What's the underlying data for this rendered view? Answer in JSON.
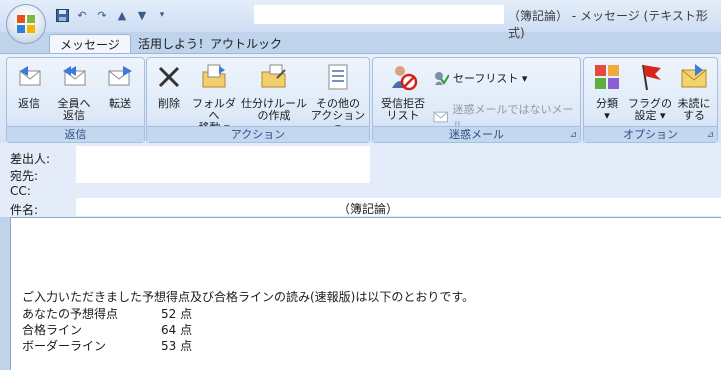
{
  "window": {
    "title": "（簿記論） - メッセージ (テキスト形式)"
  },
  "quick_access": [
    "save-icon",
    "undo-icon",
    "redo-icon",
    "up-arrow-icon",
    "down-arrow-icon",
    "customize-icon"
  ],
  "tabs": [
    {
      "label": "メッセージ"
    },
    {
      "label": "活用しよう！アウトルック"
    }
  ],
  "ribbon": {
    "groups": [
      {
        "label": "返信",
        "buttons": [
          {
            "label1": "返信",
            "label2": "",
            "icon": "reply-icon"
          },
          {
            "label1": "全員へ",
            "label2": "返信",
            "icon": "reply-all-icon"
          },
          {
            "label1": "転送",
            "label2": "",
            "icon": "forward-icon"
          }
        ]
      },
      {
        "label": "アクション",
        "buttons": [
          {
            "label1": "削除",
            "label2": "",
            "icon": "delete-icon"
          },
          {
            "label1": "フォルダへ",
            "label2": "移動 ▾",
            "icon": "move-folder-icon"
          },
          {
            "label1": "仕分けルール",
            "label2": "の作成",
            "icon": "create-rule-icon"
          },
          {
            "label1": "その他の",
            "label2": "アクション ▾",
            "icon": "other-actions-icon"
          }
        ]
      },
      {
        "label": "迷惑メール",
        "buttons": [
          {
            "label1": "受信拒否",
            "label2": "リスト",
            "icon": "block-sender-icon"
          }
        ],
        "small": [
          {
            "label": "セーフリスト ▾",
            "icon": "safe-list-icon"
          },
          {
            "label": "迷惑メールではないメール",
            "icon": "not-junk-icon"
          }
        ]
      },
      {
        "label": "オプション",
        "buttons": [
          {
            "label1": "分類",
            "label2": "▾",
            "icon": "categorize-icon"
          },
          {
            "label1": "フラグの",
            "label2": "設定 ▾",
            "icon": "flag-icon"
          },
          {
            "label1": "未読に",
            "label2": "する",
            "icon": "mark-unread-icon"
          }
        ]
      }
    ]
  },
  "header": {
    "from_label": "差出人:",
    "from_value": "",
    "to_label": "宛先:",
    "to_value": "",
    "cc_label": "CC:",
    "cc_value": "",
    "subject_label": "件名:",
    "subject_value": "（簿記論）"
  },
  "body": {
    "intro": "ご入力いただきました予想得点及び合格ラインの読み(速報版)は以下のとおりです。",
    "rows": [
      {
        "label": "あなたの予想得点",
        "value": "52 点"
      },
      {
        "label": "合格ライン",
        "value": "64 点"
      },
      {
        "label": "ボーダーライン",
        "value": "53 点"
      }
    ]
  }
}
